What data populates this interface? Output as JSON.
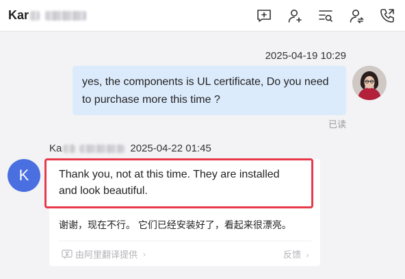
{
  "header": {
    "contact_name_visible": "Kar",
    "icons": [
      "add-message-icon",
      "add-contact-icon",
      "search-list-icon",
      "transfer-contact-icon",
      "phone-call-icon"
    ]
  },
  "messages": {
    "outgoing": {
      "time": "2025-04-19 10:29",
      "text": "yes, the components is  UL certificate,  Do you need to purchase more this time ?",
      "status": "已读"
    },
    "incoming": {
      "sender_visible": "Ka",
      "time": "2025-04-22 01:45",
      "avatar_letter": "K",
      "text": "Thank you, not at this time. They are installed and look beautiful.",
      "translation": "谢谢，现在不行。 它们已经安装好了，看起来很漂亮。",
      "provider": "由阿里翻译提供",
      "provider_chevron": "›",
      "feedback": "反馈",
      "feedback_chevron": "›"
    }
  },
  "colors": {
    "outgoing_bubble": "#dcebfc",
    "highlight_border": "#e8394b",
    "avatar_k": "#4a6fe0"
  }
}
